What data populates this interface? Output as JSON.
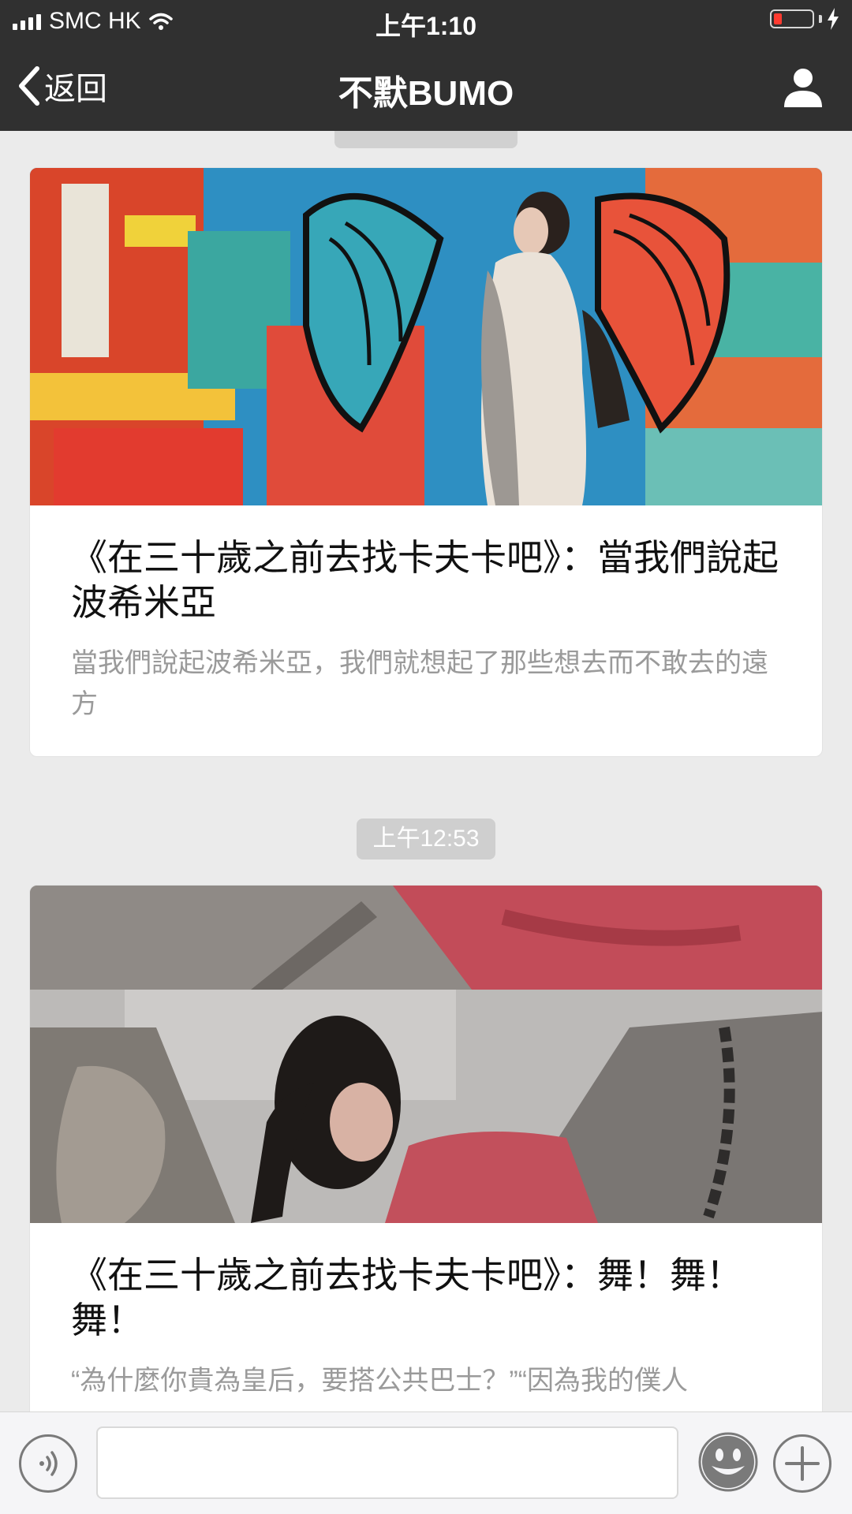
{
  "status_bar": {
    "carrier": "SMC HK",
    "time": "上午1:10"
  },
  "nav": {
    "back_label": "返回",
    "title": "不默BUMO"
  },
  "feed": {
    "items": [
      {
        "image_icon": "graffiti-wall-photo",
        "title": "《在三十歲之前去找卡夫卡吧》：當我們說起波希米亞",
        "description": "當我們說起波希米亞，我們就想起了那些想去而不敢去的遠方"
      },
      {
        "timestamp": "上午12:53",
        "image_icon": "red-dress-portrait-photo",
        "title": "《在三十歲之前去找卡夫卡吧》：舞！舞！舞！",
        "description": "“為什麼你貴為皇后，要搭公共巴士？”“因為我的僕人"
      }
    ]
  },
  "input_bar": {
    "placeholder": ""
  },
  "colors": {
    "header_bg": "#303030",
    "page_bg": "#ebebeb",
    "battery_low": "#ff3b30"
  }
}
